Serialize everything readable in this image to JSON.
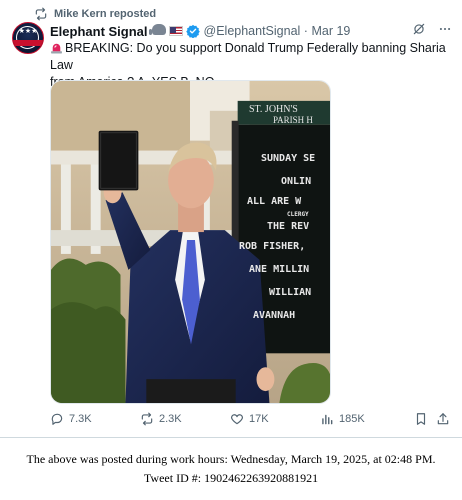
{
  "repost": {
    "label": "Mike Kern reposted",
    "icon": "repost-icon"
  },
  "author": {
    "name": "Elephant Signal",
    "badges": [
      "elephant-emoji",
      "us-flag-emoji",
      "verified-badge-icon"
    ],
    "handle": "@ElephantSignal",
    "separator": "·",
    "date": "Mar 19",
    "accent": "#1d9bf0"
  },
  "tweet": {
    "siren_icon": "siren-emoji",
    "text_line1": "BREAKING: Do you support Donald Trump Federally banning Sharia Law",
    "text_line2": "from America ? A. YES B. NO"
  },
  "media": {
    "sign": {
      "line1": "ST. JOHN'S",
      "line2": "PARISH H",
      "rows": [
        "SUNDAY SE",
        "ONLIN",
        "ALL ARE W",
        "CLERGY",
        "THE REV",
        "ROB FISHER,",
        "ANE MILLIN",
        "WILLIAN",
        "AVANNAH"
      ]
    }
  },
  "actions": {
    "replies": "7.3K",
    "reposts": "2.3K",
    "likes": "17K",
    "views": "185K"
  },
  "caption": {
    "line1": "The above was posted during work hours: Wednesday, March 19, 2025, at 02:48 PM.",
    "line2": "Tweet ID #: 1902462263920881921"
  }
}
